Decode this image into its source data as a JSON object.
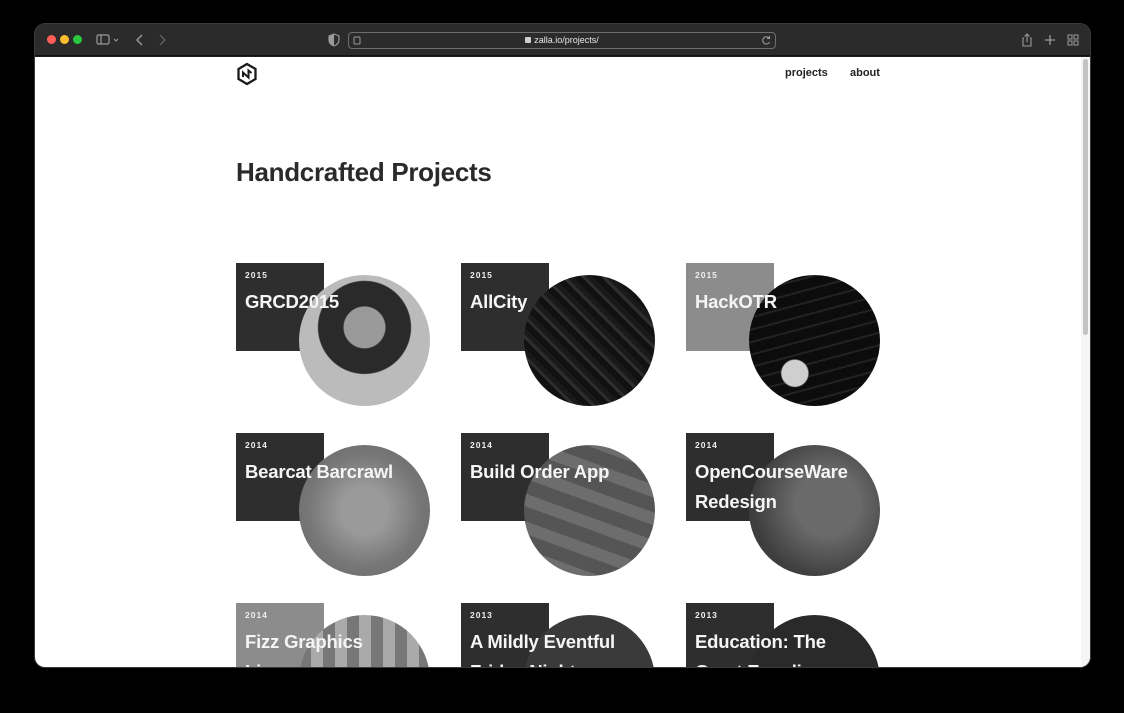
{
  "browser": {
    "url": "zalla.io/projects/"
  },
  "site": {
    "nav": {
      "projects": "projects",
      "about": "about"
    },
    "page_title": "Handcrafted Projects"
  },
  "projects": [
    {
      "year": "2015",
      "title": "GRCD2015"
    },
    {
      "year": "2015",
      "title": "AllCity"
    },
    {
      "year": "2015",
      "title": "HackOTR"
    },
    {
      "year": "2014",
      "title": "Bearcat Barcrawl"
    },
    {
      "year": "2014",
      "title": "Build Order App"
    },
    {
      "year": "2014",
      "title": "OpenCourseWare Redesign"
    },
    {
      "year": "2014",
      "title": "Fizz Graphics Li..."
    },
    {
      "year": "2013",
      "title": "A Mildly Eventful Friday Night"
    },
    {
      "year": "2013",
      "title": "Education: The Great Equali..."
    }
  ],
  "colors": {
    "card_dark": "#2e2e2e",
    "card_light": "#8c8c8c",
    "text": "#222222"
  }
}
